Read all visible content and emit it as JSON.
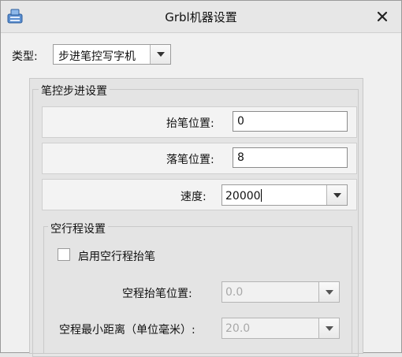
{
  "window": {
    "title": "Grbl机器设置",
    "icon": "app-icon"
  },
  "type_row": {
    "label": "类型:",
    "selected": "步进笔控写字机"
  },
  "pen_group": {
    "title": "笔控步进设置",
    "pen_up": {
      "label": "抬笔位置:",
      "value": "0"
    },
    "pen_down": {
      "label": "落笔位置:",
      "value": "8"
    },
    "speed": {
      "label": "速度:",
      "value": "20000"
    }
  },
  "idle_group": {
    "title": "空行程设置",
    "enable_checkbox": {
      "label": "启用空行程抬笔",
      "checked": false
    },
    "idle_pen_up": {
      "label": "空程抬笔位置:",
      "value": "0.0"
    },
    "min_distance": {
      "label": "空程最小距离（单位毫米）:",
      "value": "20.0"
    }
  },
  "colors": {
    "window_bg": "#f0f0f0",
    "panel_bg": "#e4e4e4",
    "disabled_text": "#a8a8a8"
  }
}
